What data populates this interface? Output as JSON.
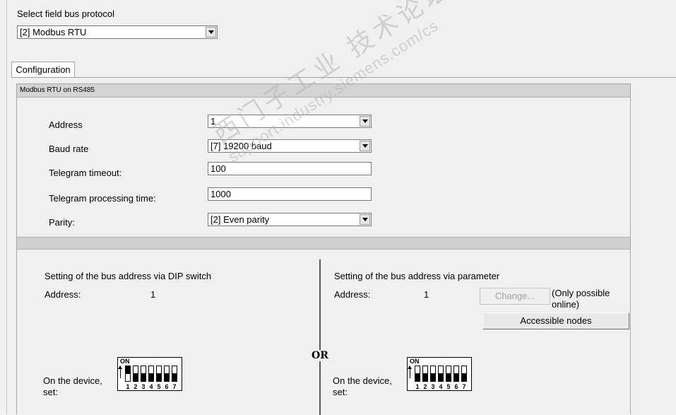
{
  "protocol": {
    "label": "Select field bus protocol",
    "selected": "[2] Modbus RTU"
  },
  "tabs": [
    {
      "label": "Configuration"
    }
  ],
  "panel": {
    "title": "Modbus RTU on RS485",
    "fields": {
      "address": {
        "label": "Address",
        "value": "1"
      },
      "baud_rate": {
        "label": "Baud rate",
        "value": "[7] 19200 baud"
      },
      "telegram_timeout": {
        "label": "Telegram timeout:",
        "value": "100"
      },
      "processing_time": {
        "label": "Telegram processing time:",
        "value": "1000"
      },
      "parity": {
        "label": "Parity:",
        "value": "[2] Even parity"
      }
    }
  },
  "dip_section": {
    "title": "Setting of the bus address via DIP switch",
    "address_label": "Address:",
    "address_value": "1",
    "device_label": "On the device,\nset:"
  },
  "param_section": {
    "title": "Setting of the bus address via parameter",
    "address_label": "Address:",
    "address_value": "1",
    "change_button": "Change...",
    "online_note": "(Only possible\nonline)",
    "accessible_button": "Accessible nodes",
    "device_label": "On the device,\nset:"
  },
  "or_label": "OR",
  "dip_switch": {
    "on_label": "ON",
    "numbers": [
      "1",
      "2",
      "3",
      "4",
      "5",
      "6",
      "7"
    ],
    "states_on": [
      true,
      false,
      false,
      false,
      false,
      false,
      false
    ]
  },
  "watermark": {
    "line1": "西门子工业 技术论坛",
    "line2": "support.industry.siemens.com/cs"
  }
}
